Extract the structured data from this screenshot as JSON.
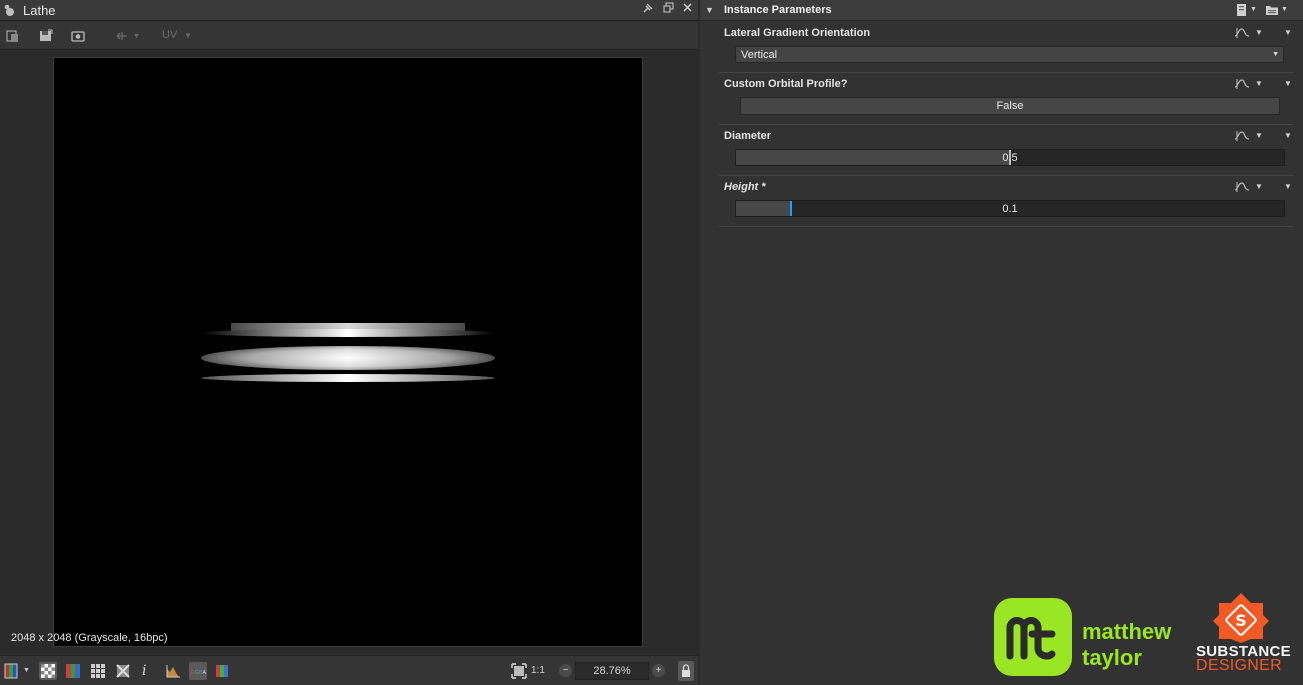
{
  "viewer": {
    "title": "Lathe",
    "toolbar": {
      "uv_label": "UV"
    },
    "resolution_text": "2048 x 2048 (Grayscale, 16bpc)",
    "zoom_ratio_label": "1:1",
    "zoom_value": "28.76%",
    "zoom_minus": "−",
    "zoom_plus": "+"
  },
  "params": {
    "section_title": "Instance Parameters",
    "items": [
      {
        "label": "Lateral Gradient Orientation",
        "type": "dropdown",
        "value": "Vertical"
      },
      {
        "label": "Custom Orbital Profile?",
        "type": "toggle",
        "value": "False"
      },
      {
        "label": "Diameter",
        "type": "slider",
        "value": "0.5",
        "fraction": 0.5
      },
      {
        "label": "Height *",
        "type": "slider",
        "value": "0.1",
        "fraction": 0.1
      }
    ]
  },
  "watermark": {
    "author_line1": "matthew",
    "author_line2": "taylor",
    "brand_line1": "SUBSTANCE",
    "brand_line2": "DESIGNER"
  },
  "colors": {
    "accent_blue": "#1e9bff",
    "author_green": "#9ae524",
    "brand_orange": "#f15a24"
  }
}
